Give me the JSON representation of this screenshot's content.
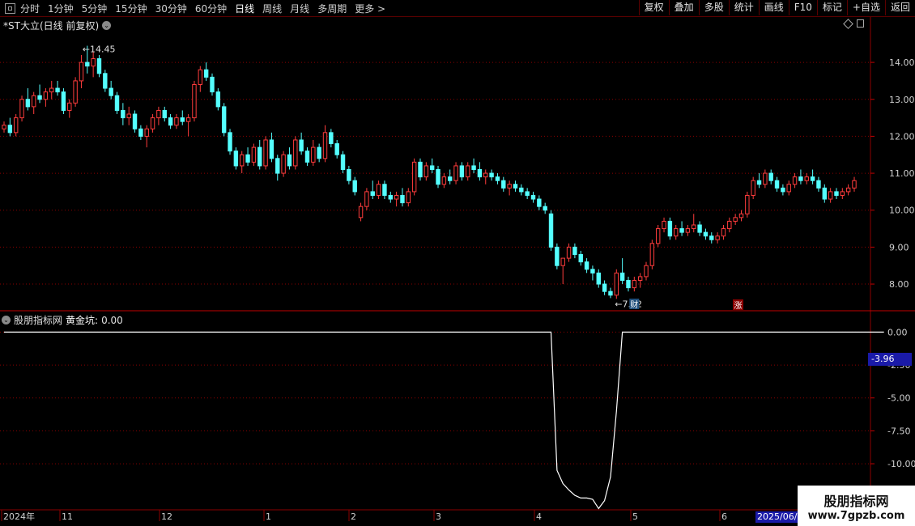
{
  "toolbar": {
    "periods": [
      "分时",
      "1分钟",
      "5分钟",
      "15分钟",
      "30分钟",
      "60分钟",
      "日线",
      "周线",
      "月线",
      "多周期",
      "更多 >"
    ],
    "active_period": "日线",
    "buttons": [
      "复权",
      "叠加",
      "多股",
      "统计",
      "画线",
      "F10",
      "标记",
      "+自选",
      "返回"
    ]
  },
  "main_pane": {
    "title": "*ST大立(日线 前复权)",
    "high_label": "14.45",
    "low_label": "7.62",
    "badge_cai": "财",
    "badge_zhang": "涨",
    "y_ticks": [
      "14.00",
      "13.00",
      "12.00",
      "11.00",
      "10.00",
      "9.00",
      "8.00"
    ]
  },
  "indicator_pane": {
    "source": "股朋指标网",
    "name": "黄金坑:",
    "value": "0.00",
    "y_ticks": [
      "0.00",
      "-2.50",
      "-5.00",
      "-7.50",
      "-10.00"
    ],
    "current_value": "-3.96"
  },
  "x_axis": {
    "labels": [
      "2024年",
      "11",
      "12",
      "1",
      "2",
      "3",
      "4",
      "5",
      "6"
    ],
    "current_date": "2025/06/"
  },
  "watermark": {
    "line1": "股朋指标网",
    "line2": "www.7gpzb.com"
  },
  "colors": {
    "up": "#ff3c3c",
    "down": "#54ffff",
    "grid": "#8b0000",
    "line": "#ffffff",
    "cursor_box": "#1a1aa8"
  },
  "chart_data": {
    "type": "candlestick",
    "ylim": [
      7.3,
      14.9
    ],
    "indicator_ylim": [
      -13.5,
      1.5
    ],
    "candles": [
      [
        12.2,
        12.4,
        12.1,
        12.3
      ],
      [
        12.3,
        12.5,
        12.0,
        12.1
      ],
      [
        12.1,
        12.6,
        12.0,
        12.5
      ],
      [
        12.5,
        13.1,
        12.4,
        13.0
      ],
      [
        13.0,
        13.3,
        12.7,
        12.8
      ],
      [
        12.8,
        13.2,
        12.6,
        13.1
      ],
      [
        13.1,
        13.4,
        12.9,
        13.0
      ],
      [
        13.0,
        13.3,
        12.8,
        13.2
      ],
      [
        13.2,
        13.5,
        13.0,
        13.3
      ],
      [
        13.3,
        13.5,
        13.1,
        13.2
      ],
      [
        13.2,
        13.3,
        12.6,
        12.7
      ],
      [
        12.7,
        13.0,
        12.5,
        12.9
      ],
      [
        12.9,
        13.6,
        12.8,
        13.5
      ],
      [
        13.5,
        14.2,
        13.3,
        14.0
      ],
      [
        14.0,
        14.45,
        13.7,
        13.9
      ],
      [
        13.9,
        14.3,
        13.6,
        14.1
      ],
      [
        14.1,
        14.2,
        13.6,
        13.7
      ],
      [
        13.7,
        13.8,
        13.2,
        13.3
      ],
      [
        13.3,
        13.5,
        13.0,
        13.1
      ],
      [
        13.1,
        13.2,
        12.6,
        12.7
      ],
      [
        12.7,
        12.9,
        12.3,
        12.5
      ],
      [
        12.5,
        12.8,
        12.3,
        12.6
      ],
      [
        12.6,
        12.7,
        12.1,
        12.2
      ],
      [
        12.2,
        12.3,
        11.9,
        12.0
      ],
      [
        12.0,
        12.3,
        11.7,
        12.2
      ],
      [
        12.2,
        12.6,
        12.1,
        12.5
      ],
      [
        12.5,
        12.8,
        12.3,
        12.7
      ],
      [
        12.7,
        12.8,
        12.4,
        12.5
      ],
      [
        12.5,
        12.6,
        12.2,
        12.3
      ],
      [
        12.3,
        12.6,
        12.2,
        12.5
      ],
      [
        12.5,
        12.7,
        12.3,
        12.4
      ],
      [
        12.4,
        12.6,
        12.0,
        12.5
      ],
      [
        12.5,
        13.5,
        12.4,
        13.4
      ],
      [
        13.4,
        13.9,
        13.2,
        13.8
      ],
      [
        13.8,
        14.0,
        13.5,
        13.6
      ],
      [
        13.6,
        13.7,
        13.1,
        13.2
      ],
      [
        13.2,
        13.3,
        12.7,
        12.8
      ],
      [
        12.8,
        12.9,
        12.0,
        12.1
      ],
      [
        12.1,
        12.2,
        11.5,
        11.6
      ],
      [
        11.6,
        11.7,
        11.1,
        11.2
      ],
      [
        11.2,
        11.6,
        11.0,
        11.5
      ],
      [
        11.5,
        11.7,
        11.2,
        11.3
      ],
      [
        11.3,
        11.8,
        11.2,
        11.7
      ],
      [
        11.7,
        11.9,
        11.1,
        11.2
      ],
      [
        11.2,
        12.0,
        11.1,
        11.9
      ],
      [
        11.9,
        12.1,
        11.3,
        11.4
      ],
      [
        11.4,
        11.5,
        10.8,
        11.0
      ],
      [
        11.0,
        11.6,
        10.9,
        11.5
      ],
      [
        11.5,
        11.7,
        11.1,
        11.2
      ],
      [
        11.2,
        12.0,
        11.1,
        11.9
      ],
      [
        11.9,
        12.1,
        11.5,
        11.6
      ],
      [
        11.6,
        11.7,
        11.2,
        11.3
      ],
      [
        11.3,
        11.9,
        11.2,
        11.7
      ],
      [
        11.7,
        11.8,
        11.3,
        11.4
      ],
      [
        11.4,
        12.3,
        11.3,
        12.1
      ],
      [
        12.1,
        12.2,
        11.7,
        11.8
      ],
      [
        11.8,
        11.9,
        11.4,
        11.5
      ],
      [
        11.5,
        11.6,
        11.0,
        11.1
      ],
      [
        11.1,
        11.2,
        10.7,
        10.8
      ],
      [
        10.8,
        10.9,
        10.4,
        10.5
      ],
      [
        9.8,
        10.2,
        9.7,
        10.1
      ],
      [
        10.1,
        10.6,
        10.0,
        10.5
      ],
      [
        10.5,
        10.8,
        10.3,
        10.4
      ],
      [
        10.4,
        10.8,
        10.3,
        10.7
      ],
      [
        10.7,
        10.8,
        10.3,
        10.4
      ],
      [
        10.4,
        10.5,
        10.2,
        10.3
      ],
      [
        10.3,
        10.5,
        10.1,
        10.4
      ],
      [
        10.4,
        10.6,
        10.1,
        10.2
      ],
      [
        10.2,
        10.6,
        10.1,
        10.5
      ],
      [
        10.5,
        11.4,
        10.4,
        11.3
      ],
      [
        11.3,
        11.4,
        10.8,
        10.9
      ],
      [
        10.9,
        11.3,
        10.8,
        11.2
      ],
      [
        11.2,
        11.4,
        11.0,
        11.1
      ],
      [
        11.1,
        11.2,
        10.6,
        10.7
      ],
      [
        10.7,
        11.0,
        10.6,
        10.9
      ],
      [
        10.9,
        11.1,
        10.7,
        10.8
      ],
      [
        10.8,
        11.3,
        10.7,
        11.2
      ],
      [
        11.2,
        11.3,
        10.8,
        10.9
      ],
      [
        10.9,
        11.3,
        10.8,
        11.2
      ],
      [
        11.2,
        11.4,
        11.0,
        11.1
      ],
      [
        11.1,
        11.3,
        10.8,
        10.9
      ],
      [
        10.9,
        11.1,
        10.7,
        11.0
      ],
      [
        11.0,
        11.1,
        10.8,
        10.9
      ],
      [
        10.9,
        11.0,
        10.7,
        10.8
      ],
      [
        10.8,
        10.9,
        10.5,
        10.6
      ],
      [
        10.6,
        10.8,
        10.4,
        10.7
      ],
      [
        10.7,
        10.8,
        10.5,
        10.6
      ],
      [
        10.6,
        10.7,
        10.4,
        10.5
      ],
      [
        10.5,
        10.6,
        10.3,
        10.4
      ],
      [
        10.4,
        10.5,
        10.2,
        10.3
      ],
      [
        10.3,
        10.4,
        10.0,
        10.1
      ],
      [
        10.1,
        10.2,
        9.9,
        10.0
      ],
      [
        9.9,
        10.0,
        8.9,
        9.0
      ],
      [
        9.0,
        9.1,
        8.4,
        8.5
      ],
      [
        8.5,
        8.6,
        8.0,
        8.7
      ],
      [
        8.7,
        9.1,
        8.6,
        9.0
      ],
      [
        9.0,
        9.1,
        8.7,
        8.8
      ],
      [
        8.8,
        8.9,
        8.5,
        8.6
      ],
      [
        8.6,
        8.7,
        8.3,
        8.4
      ],
      [
        8.4,
        8.5,
        8.1,
        8.3
      ],
      [
        8.3,
        8.4,
        7.9,
        8.0
      ],
      [
        8.0,
        8.1,
        7.7,
        7.8
      ],
      [
        7.8,
        7.9,
        7.62,
        7.7
      ],
      [
        7.7,
        8.4,
        7.6,
        8.3
      ],
      [
        8.3,
        8.7,
        8.0,
        8.1
      ],
      [
        8.1,
        8.2,
        7.8,
        7.9
      ],
      [
        7.9,
        8.2,
        7.8,
        8.1
      ],
      [
        8.1,
        8.3,
        7.9,
        8.2
      ],
      [
        8.2,
        8.6,
        8.1,
        8.5
      ],
      [
        8.5,
        9.2,
        8.4,
        9.1
      ],
      [
        9.1,
        9.6,
        9.0,
        9.5
      ],
      [
        9.5,
        9.8,
        9.4,
        9.7
      ],
      [
        9.7,
        9.8,
        9.2,
        9.3
      ],
      [
        9.3,
        9.6,
        9.2,
        9.5
      ],
      [
        9.5,
        9.7,
        9.3,
        9.4
      ],
      [
        9.4,
        9.6,
        9.3,
        9.5
      ],
      [
        9.5,
        9.9,
        9.4,
        9.6
      ],
      [
        9.6,
        9.7,
        9.3,
        9.4
      ],
      [
        9.4,
        9.5,
        9.2,
        9.3
      ],
      [
        9.3,
        9.4,
        9.1,
        9.2
      ],
      [
        9.2,
        9.4,
        9.1,
        9.3
      ],
      [
        9.3,
        9.6,
        9.2,
        9.5
      ],
      [
        9.5,
        9.8,
        9.4,
        9.7
      ],
      [
        9.7,
        9.9,
        9.6,
        9.8
      ],
      [
        9.8,
        10.0,
        9.7,
        9.9
      ],
      [
        9.9,
        10.5,
        9.8,
        10.4
      ],
      [
        10.4,
        10.9,
        10.3,
        10.8
      ],
      [
        10.8,
        11.0,
        10.6,
        10.7
      ],
      [
        10.7,
        11.1,
        10.6,
        11.0
      ],
      [
        11.0,
        11.1,
        10.7,
        10.8
      ],
      [
        10.8,
        10.9,
        10.5,
        10.6
      ],
      [
        10.6,
        10.7,
        10.4,
        10.5
      ],
      [
        10.5,
        10.8,
        10.4,
        10.7
      ],
      [
        10.7,
        11.0,
        10.6,
        10.9
      ],
      [
        10.9,
        11.1,
        10.7,
        10.8
      ],
      [
        10.8,
        11.0,
        10.7,
        10.9
      ],
      [
        10.9,
        11.1,
        10.7,
        10.8
      ],
      [
        10.8,
        10.9,
        10.5,
        10.6
      ],
      [
        10.6,
        10.7,
        10.2,
        10.3
      ],
      [
        10.3,
        10.6,
        10.2,
        10.5
      ],
      [
        10.5,
        10.6,
        10.3,
        10.4
      ],
      [
        10.4,
        10.6,
        10.3,
        10.5
      ],
      [
        10.5,
        10.7,
        10.4,
        10.6
      ],
      [
        10.6,
        10.9,
        10.5,
        10.8
      ]
    ],
    "indicator": [
      0,
      0,
      0,
      0,
      0,
      0,
      0,
      0,
      0,
      0,
      0,
      0,
      0,
      0,
      0,
      0,
      0,
      0,
      0,
      0,
      0,
      0,
      0,
      0,
      0,
      0,
      0,
      0,
      0,
      0,
      0,
      0,
      0,
      0,
      0,
      0,
      0,
      0,
      0,
      0,
      0,
      0,
      0,
      0,
      0,
      0,
      0,
      0,
      0,
      0,
      0,
      0,
      0,
      0,
      0,
      0,
      0,
      0,
      0,
      0,
      0,
      0,
      0,
      0,
      0,
      0,
      0,
      0,
      0,
      0,
      0,
      0,
      0,
      0,
      0,
      0,
      0,
      0,
      0,
      0,
      0,
      0,
      0,
      0,
      0,
      0,
      0,
      0,
      0,
      0,
      0,
      0,
      0,
      -10.5,
      -11.5,
      -12.0,
      -12.4,
      -12.6,
      -12.6,
      -12.7,
      -13.4,
      -12.8,
      -11.0,
      -6.0,
      0,
      0,
      0,
      0,
      0,
      0,
      0,
      0,
      0,
      0,
      0,
      0,
      0,
      0,
      0,
      0,
      0,
      0,
      0,
      0,
      0,
      0,
      0,
      0,
      0,
      0,
      0,
      0,
      0,
      0,
      0,
      0,
      0,
      0,
      0,
      0,
      0,
      0,
      0,
      0,
      0,
      0,
      0,
      0,
      0
    ]
  }
}
